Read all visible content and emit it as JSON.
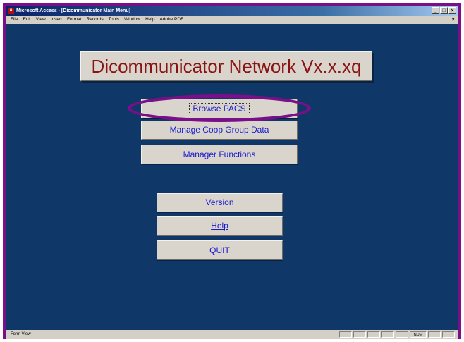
{
  "window": {
    "title": "Microsoft Access - [Dicommunicator Main Menu]",
    "controls": {
      "minimize": "_",
      "restore": "□",
      "close": "×"
    }
  },
  "menubar": {
    "items": [
      "File",
      "Edit",
      "View",
      "Insert",
      "Format",
      "Records",
      "Tools",
      "Window",
      "Help",
      "Adobe PDF"
    ],
    "close_doc": "×"
  },
  "form": {
    "banner": "Dicommunicator Network Vx.x.xq",
    "buttons": {
      "browse_pacs": "Browse PACS",
      "manage_coop": "Manage Coop Group Data",
      "manager_functions": "Manager Functions",
      "version": "Version",
      "help": "Help",
      "quit": "QUIT"
    }
  },
  "statusbar": {
    "text": "Form View",
    "num_indicator": "NUM"
  },
  "colors": {
    "form_background": "#0f3868",
    "highlight_ring": "#7a0f8a",
    "banner_text": "#8a1212",
    "button_text": "#1a1acc"
  }
}
